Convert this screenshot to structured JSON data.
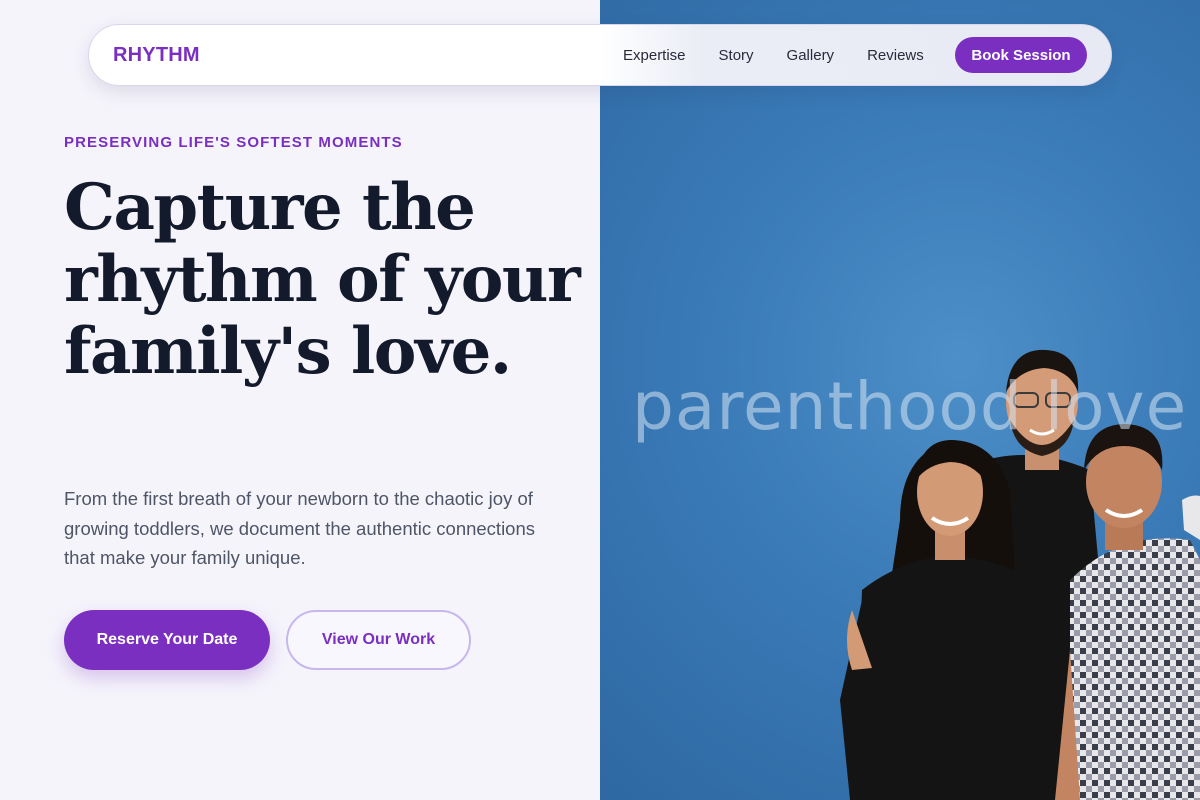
{
  "nav": {
    "brand": "RHYTHM",
    "links": [
      "Expertise",
      "Story",
      "Gallery",
      "Reviews"
    ],
    "cta": "Book Session"
  },
  "hero": {
    "eyebrow": "PRESERVING LIFE'S SOFTEST MOMENTS",
    "headline": "Capture the rhythm of your family's love.",
    "lede": "From the first breath of your newborn to the chaotic joy of growing toddlers, we document the authentic connections that make your family unique.",
    "primary_button": "Reserve Your Date",
    "secondary_button": "View Our Work"
  },
  "image": {
    "watermark": "parenthood love",
    "description_icon": "family-photo"
  },
  "colors": {
    "accent": "#7a2fc0",
    "text_dark": "#131a2c",
    "text_body": "#4e5566",
    "page_bg": "#f5f4fb",
    "photo_bg": "#3a7bb8"
  }
}
